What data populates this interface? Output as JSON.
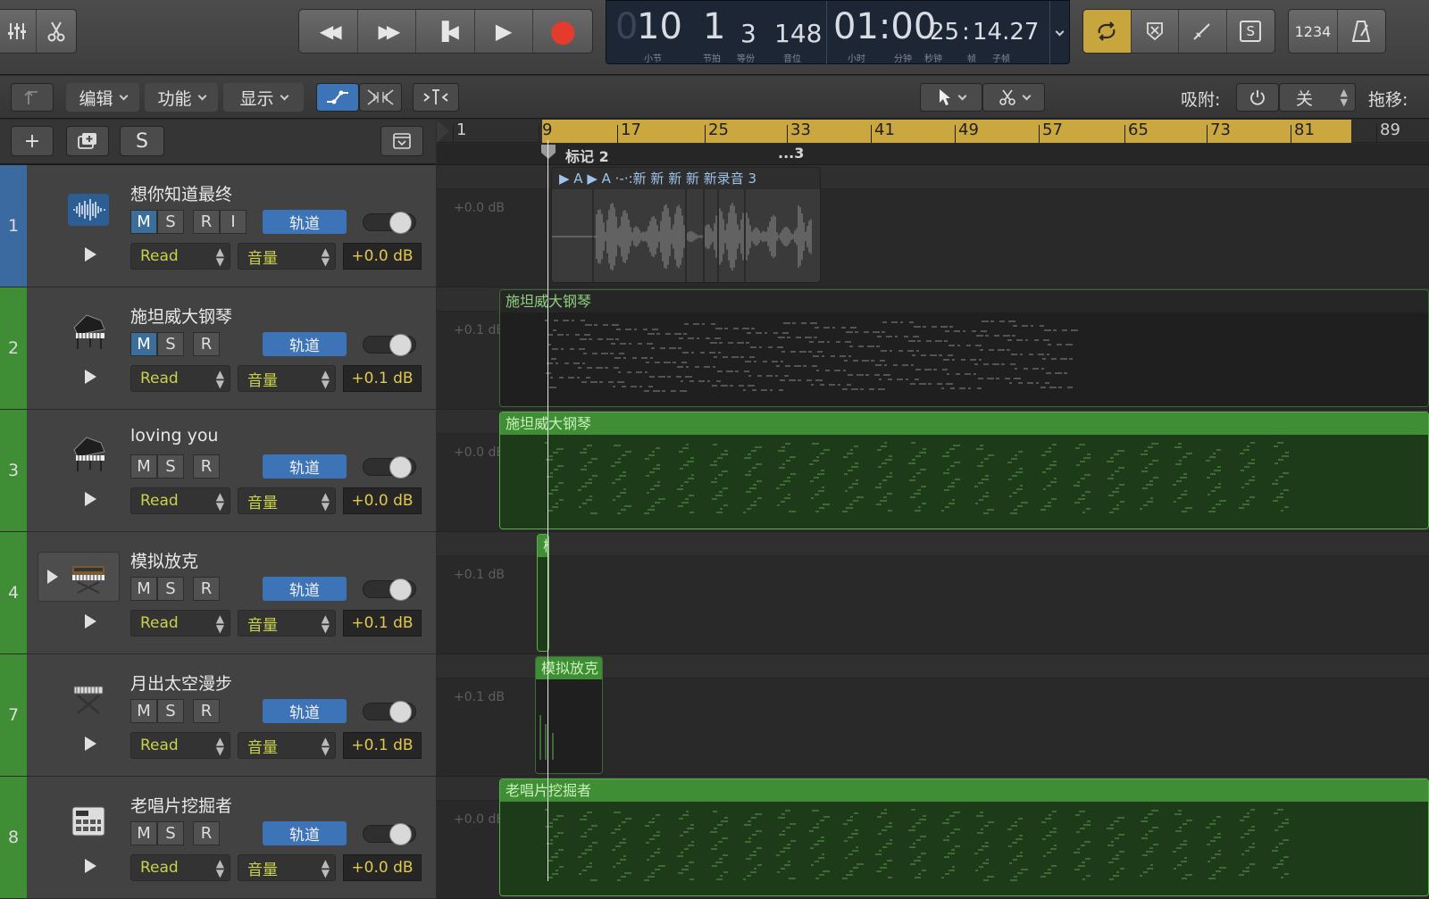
{
  "transport": {
    "rewind": "◀◀",
    "forward": "▶▶",
    "to_start": "▐◀",
    "play": "▶",
    "record": "●"
  },
  "lcd": {
    "bar": "10",
    "beat": "1",
    "division": "3",
    "tick": "148",
    "time_main": "01:00",
    "time_sub": "25",
    "time_frames": "14.27",
    "labels": {
      "bar": "小节",
      "beat": "节拍",
      "division": "等份",
      "tick": "音位",
      "hour": "小时",
      "minute": "分钟",
      "second": "秒钟",
      "frame": "帧",
      "subframe": "子帧"
    }
  },
  "right_tools": {
    "count_in": "1234"
  },
  "menus": {
    "edit": "编辑",
    "functions": "功能",
    "view": "显示"
  },
  "snap": {
    "label": "吸附:",
    "value": "关"
  },
  "drag": {
    "label": "拖移:"
  },
  "track_header": {
    "add": "+",
    "solo_all": "S"
  },
  "ruler": {
    "marks": [
      "1",
      "9",
      "17",
      "25",
      "33",
      "41",
      "49",
      "57",
      "65",
      "73",
      "81",
      "89"
    ],
    "marker_text": "标记 2",
    "marker_text2": "...3"
  },
  "tracks": [
    {
      "num": "1",
      "name": "想你知道最终",
      "m": "M",
      "s": "S",
      "r": "R",
      "i": "I",
      "track_btn": "轨道",
      "auto": "Read",
      "param": "音量",
      "db": "+0.0 dB",
      "lane_db": "+0.0 dB",
      "icon": "audio-waveform-icon",
      "color": "#3a6aa0"
    },
    {
      "num": "2",
      "name": "施坦威大钢琴",
      "m": "M",
      "s": "S",
      "r": "R",
      "track_btn": "轨道",
      "auto": "Read",
      "param": "音量",
      "db": "+0.1 dB",
      "lane_db": "+0.1 dB",
      "icon": "grand-piano-icon",
      "color": "#3f8d35",
      "region": "施坦威大钢琴"
    },
    {
      "num": "3",
      "name": "loving you",
      "m": "M",
      "s": "S",
      "r": "R",
      "track_btn": "轨道",
      "auto": "Read",
      "param": "音量",
      "db": "+0.0 dB",
      "lane_db": "+0.0 dB",
      "icon": "grand-piano-icon",
      "color": "#3f8d35",
      "region": "施坦威大钢琴"
    },
    {
      "num": "4",
      "name": "模拟放克",
      "m": "M",
      "s": "S",
      "r": "R",
      "track_btn": "轨道",
      "auto": "Read",
      "param": "音量",
      "db": "+0.1 dB",
      "lane_db": "+0.1 dB",
      "icon": "synth-keyboard-icon",
      "color": "#3f8d35",
      "region": "模"
    },
    {
      "num": "7",
      "name": "月出太空漫步",
      "m": "M",
      "s": "S",
      "r": "R",
      "track_btn": "轨道",
      "auto": "Read",
      "param": "音量",
      "db": "+0.1 dB",
      "lane_db": "+0.1 dB",
      "icon": "keyboard-stand-icon",
      "color": "#3f8d35",
      "region": "模拟放克"
    },
    {
      "num": "8",
      "name": "老唱片挖掘者",
      "m": "M",
      "s": "S",
      "r": "R",
      "track_btn": "轨道",
      "auto": "Read",
      "param": "音量",
      "db": "+0.0 dB",
      "lane_db": "+0.0 dB",
      "icon": "drum-machine-icon",
      "color": "#3f8d35",
      "region": "老唱片挖掘者"
    }
  ],
  "audio_region": {
    "header": "▶ A ▶ A ·-·:新 新 新 新 新录音 3"
  }
}
